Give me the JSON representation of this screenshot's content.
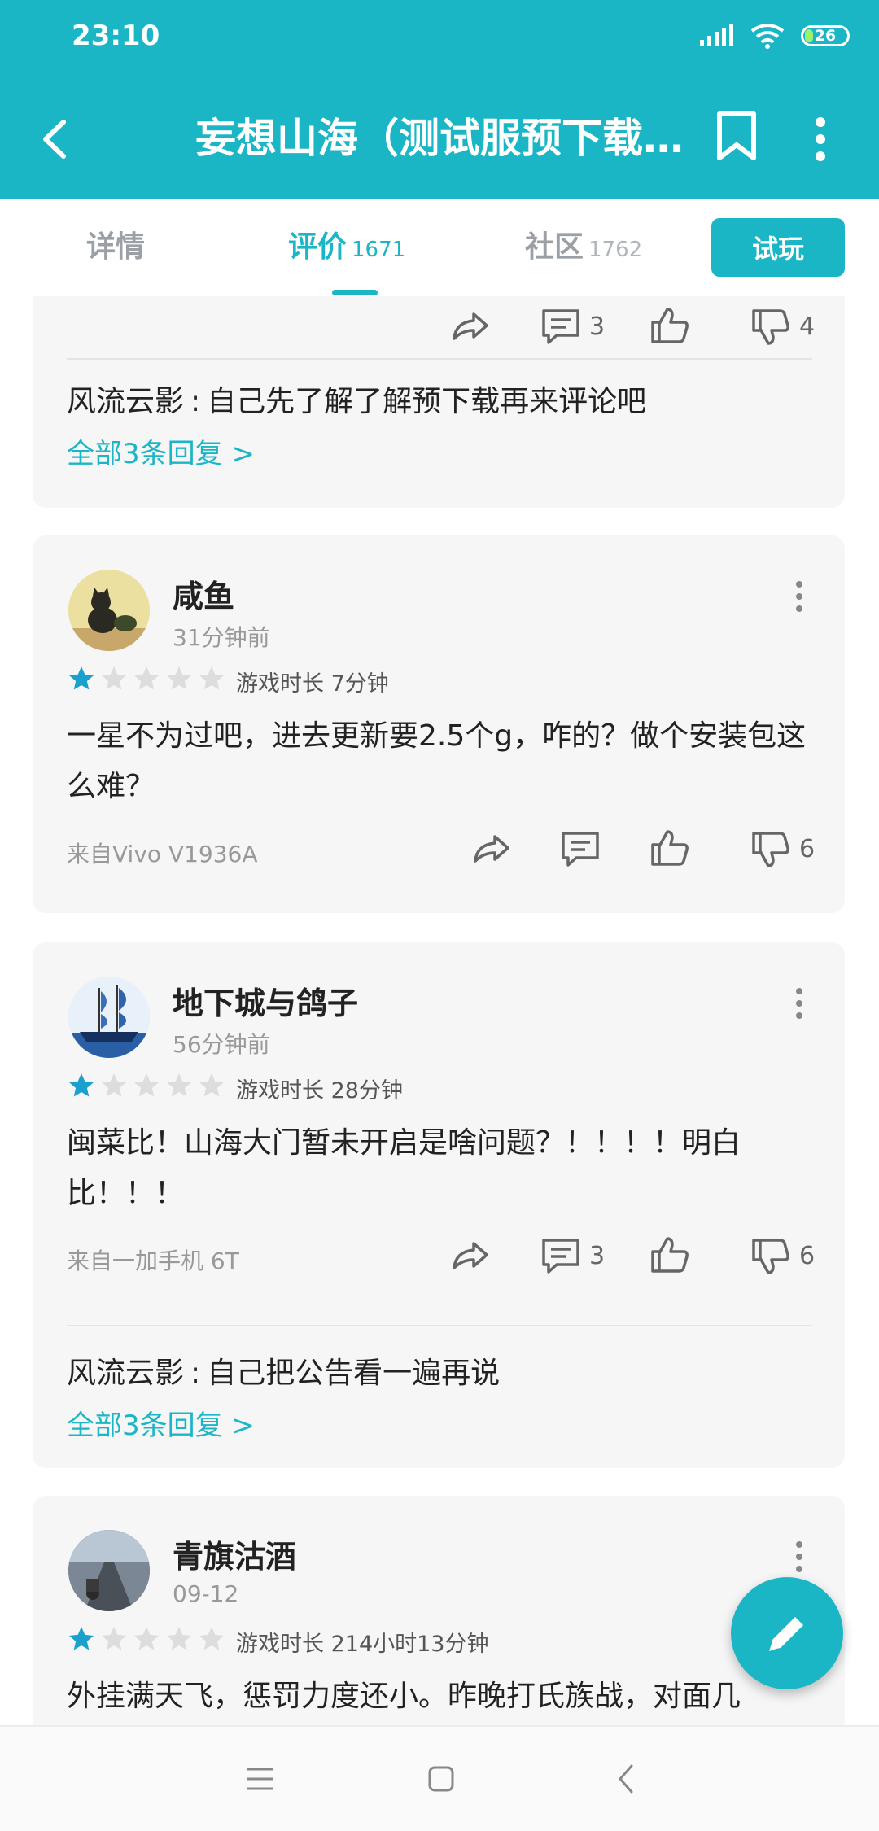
{
  "status_bar": {
    "time": "23:10",
    "battery": "26"
  },
  "app_bar": {
    "title": "妄想山海（测试服预下载..."
  },
  "tabs": [
    {
      "label": "详情",
      "count": ""
    },
    {
      "label": "评价",
      "count": "1671"
    },
    {
      "label": "社区",
      "count": "1762"
    }
  ],
  "trial_button": "试玩",
  "partial_card": {
    "comments": "3",
    "dislikes": "4",
    "reply": {
      "author": "风流云影",
      "colon": ":",
      "text": "自己先了解了解预下载再来评论吧"
    },
    "all_replies": "全部3条回复 >"
  },
  "reviews": [
    {
      "name": "咸鱼",
      "time": "31分钟前",
      "rating": 1,
      "playtime": "游戏时长 7分钟",
      "text": "一星不为过吧，进去更新要2.5个g，咋的？做个安装包这么难？",
      "device": "来自Vivo V1936A",
      "comments": "",
      "likes": "",
      "dislikes": "6"
    },
    {
      "name": "地下城与鸽子",
      "time": "56分钟前",
      "rating": 1,
      "playtime": "游戏时长 28分钟",
      "text": "闽菜比！山海大门暂未开启是啥问题？！！！！明白比！！！",
      "device": "来自一加手机 6T",
      "comments": "3",
      "likes": "",
      "dislikes": "6",
      "reply": {
        "author": "风流云影",
        "colon": ":",
        "text": "自己把公告看一遍再说"
      },
      "all_replies": "全部3条回复 >"
    },
    {
      "name": "青旗沽酒",
      "time": "09-12",
      "rating": 1,
      "playtime": "游戏时长 214小时13分钟",
      "text": "外挂满天飞，惩罚力度还小。昨晚打氏族战，对面几"
    }
  ],
  "colors": {
    "accent": "#1bb6c6",
    "star_filled": "#1aa0cc",
    "star_empty": "#dddddd"
  },
  "icons": [
    "back-arrow-icon",
    "bookmark-icon",
    "more-vertical-icon",
    "share-icon",
    "comment-icon",
    "thumbs-up-icon",
    "thumbs-down-icon",
    "edit-pencil-icon",
    "signal-icon",
    "wifi-icon"
  ]
}
